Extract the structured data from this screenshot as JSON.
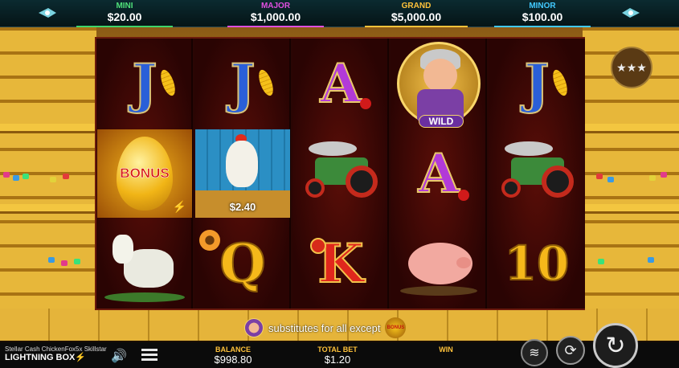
{
  "jackpots": {
    "mini": {
      "label": "MINI",
      "value": "$20.00"
    },
    "major": {
      "label": "MAJOR",
      "value": "$1,000.00"
    },
    "grand": {
      "label": "GRAND",
      "value": "$5,000.00"
    },
    "minor": {
      "label": "MINOR",
      "value": "$100.00"
    }
  },
  "reels": [
    [
      "J",
      "BONUS",
      "goat"
    ],
    [
      "J",
      "chicken",
      "Q"
    ],
    [
      "A",
      "tractor",
      "K"
    ],
    [
      "WILD",
      "A",
      "pig"
    ],
    [
      "J",
      "tractor",
      "10"
    ]
  ],
  "symbols": {
    "bonus_text": "BONUS",
    "wild_text": "WILD",
    "chicken_prize": "$2.40",
    "letter_j": "J",
    "letter_a": "A",
    "letter_q": "Q",
    "letter_k": "K",
    "number_10": "10"
  },
  "info": {
    "text": "substitutes for all except",
    "bonus_icon_text": "BONUS"
  },
  "footer": {
    "game_name": "Stellar Cash ChickenFox5x Skillstar",
    "brand": "LIGHTNING BOX",
    "balance_label": "BALANCE",
    "balance": "$998.80",
    "bet_label": "TOTAL BET",
    "bet": "$1.20",
    "win_label": "WIN",
    "win": ""
  },
  "icons": [
    "spaceship-icon",
    "rank-stars-icon",
    "speaker-icon",
    "menu-icon",
    "coin-stack-icon",
    "autoplay-icon",
    "spin-icon"
  ]
}
